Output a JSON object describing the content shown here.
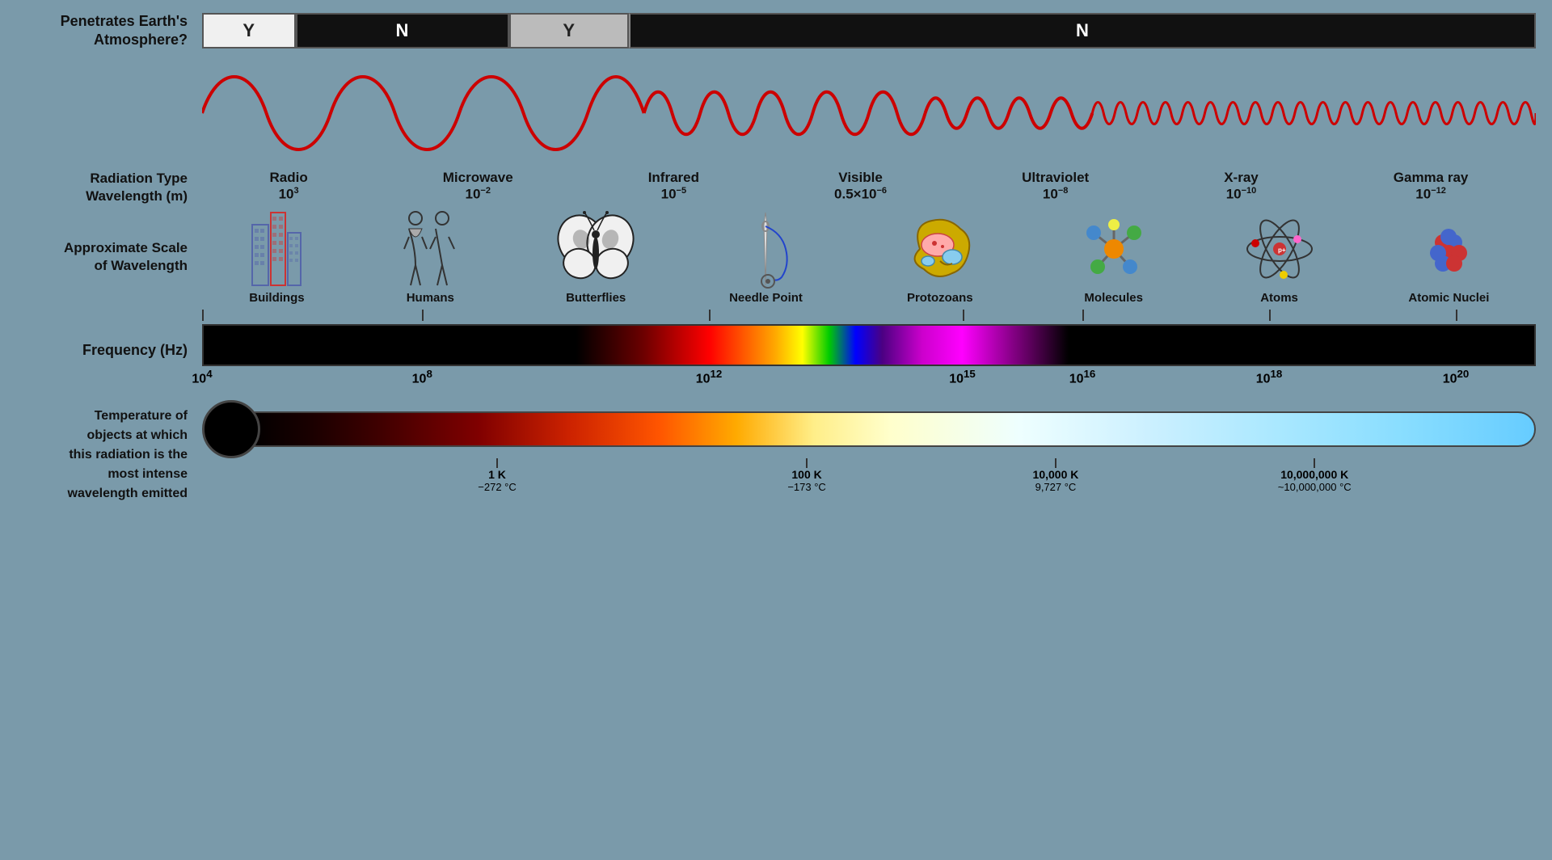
{
  "atmosphere": {
    "label": "Penetrates Earth's\nAtmosphere?",
    "segments": [
      {
        "label": "Y",
        "type": "white",
        "width": "7%"
      },
      {
        "label": "N",
        "type": "black",
        "width": "16%"
      },
      {
        "label": "Y",
        "type": "gray",
        "width": "10%"
      },
      {
        "label": "N",
        "type": "black",
        "width": "67%"
      }
    ]
  },
  "radiation": {
    "label": "Radiation Type\nWavelength (m)",
    "types": [
      {
        "name": "Radio",
        "wavelength": "10",
        "exp": "3"
      },
      {
        "name": "Microwave",
        "wavelength": "10",
        "exp": "-2"
      },
      {
        "name": "Infrared",
        "wavelength": "10",
        "exp": "-5"
      },
      {
        "name": "Visible",
        "wavelength": "0.5×10",
        "exp": "-6"
      },
      {
        "name": "Ultraviolet",
        "wavelength": "10",
        "exp": "-8"
      },
      {
        "name": "X-ray",
        "wavelength": "10",
        "exp": "-10"
      },
      {
        "name": "Gamma ray",
        "wavelength": "10",
        "exp": "-12"
      }
    ]
  },
  "scale": {
    "label": "Approximate Scale\nof Wavelength",
    "items": [
      {
        "label": "Buildings"
      },
      {
        "label": "Humans"
      },
      {
        "label": "Butterflies"
      },
      {
        "label": "Needle Point"
      },
      {
        "label": "Protozoans"
      },
      {
        "label": "Molecules"
      },
      {
        "label": "Atoms"
      },
      {
        "label": "Atomic Nuclei"
      }
    ]
  },
  "frequency": {
    "label": "Frequency (Hz)",
    "values": [
      {
        "val": "10",
        "exp": "4"
      },
      {
        "val": "10",
        "exp": "8"
      },
      {
        "val": "10",
        "exp": "12"
      },
      {
        "val": "10",
        "exp": "15"
      },
      {
        "val": "10",
        "exp": "16"
      },
      {
        "val": "10",
        "exp": "18"
      },
      {
        "val": "10",
        "exp": "20"
      }
    ]
  },
  "temperature": {
    "label": "Temperature of\nobjects at which\nthis radiation is the\nmost intense\nwavelength emitted",
    "ticks": [
      {
        "label": "1 K",
        "sublabel": "−272 °C",
        "pos": "20%"
      },
      {
        "label": "100 K",
        "sublabel": "−173 °C",
        "pos": "43%"
      },
      {
        "label": "10,000 K",
        "sublabel": "9,727 °C",
        "pos": "62%"
      },
      {
        "label": "10,000,000 K",
        "sublabel": "~10,000,000 °C",
        "pos": "82%"
      }
    ]
  },
  "colors": {
    "background": "#7a9aaa"
  }
}
